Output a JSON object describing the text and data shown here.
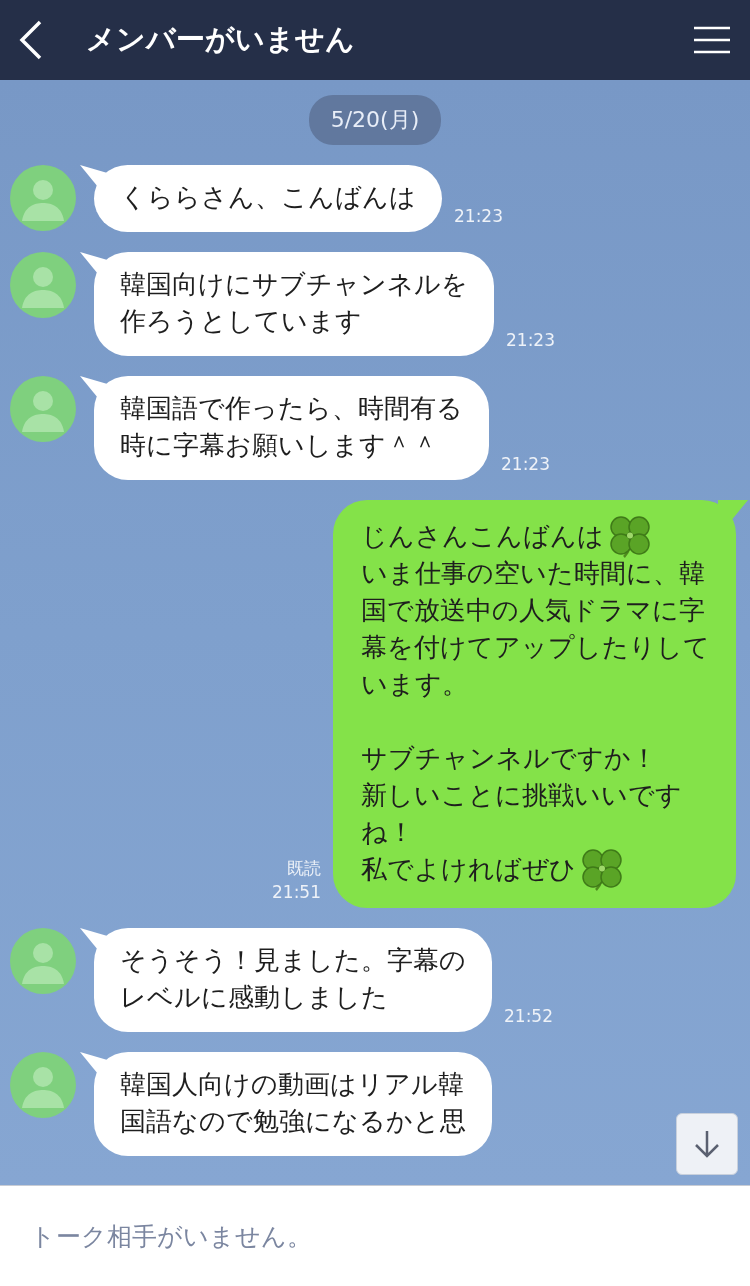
{
  "header": {
    "title": "メンバーがいません"
  },
  "date_label": "5/20(月)",
  "messages": [
    {
      "kind": "incoming",
      "lines": [
        "くららさん、こんばんは"
      ],
      "time": "21:23"
    },
    {
      "kind": "incoming",
      "lines": [
        "韓国向けにサブチャンネルを",
        "作ろうとしています"
      ],
      "time": "21:23"
    },
    {
      "kind": "incoming",
      "lines": [
        "韓国語で作ったら、時間有る",
        "時に字幕お願いします＾＾"
      ],
      "time": "21:23"
    },
    {
      "kind": "outgoing",
      "read": "既読",
      "time": "21:51",
      "paragraphs": [
        {
          "lines": [
            {
              "text": "じんさんこんばんは",
              "clover": true
            },
            {
              "text": "いま仕事の空いた時間に、韓",
              "clover": false
            },
            {
              "text": "国で放送中の人気ドラマに字",
              "clover": false
            },
            {
              "text": "幕を付けてアップしたりして",
              "clover": false
            },
            {
              "text": "います。",
              "clover": false
            }
          ]
        },
        {
          "lines": [
            {
              "text": "サブチャンネルですか！",
              "clover": false
            },
            {
              "text": "新しいことに挑戦いいです",
              "clover": false
            },
            {
              "text": "ね！",
              "clover": false
            },
            {
              "text": "私でよければぜひ",
              "clover": true
            }
          ]
        }
      ]
    },
    {
      "kind": "incoming",
      "lines": [
        "そうそう！見ました。字幕の",
        "レベルに感動しました"
      ],
      "time": "21:52"
    },
    {
      "kind": "incoming",
      "lines": [
        "韓国人向けの動画はリアル韓",
        "国語なので勉強になるかと思"
      ]
    }
  ],
  "input": {
    "placeholder": "トーク相手がいません。"
  }
}
